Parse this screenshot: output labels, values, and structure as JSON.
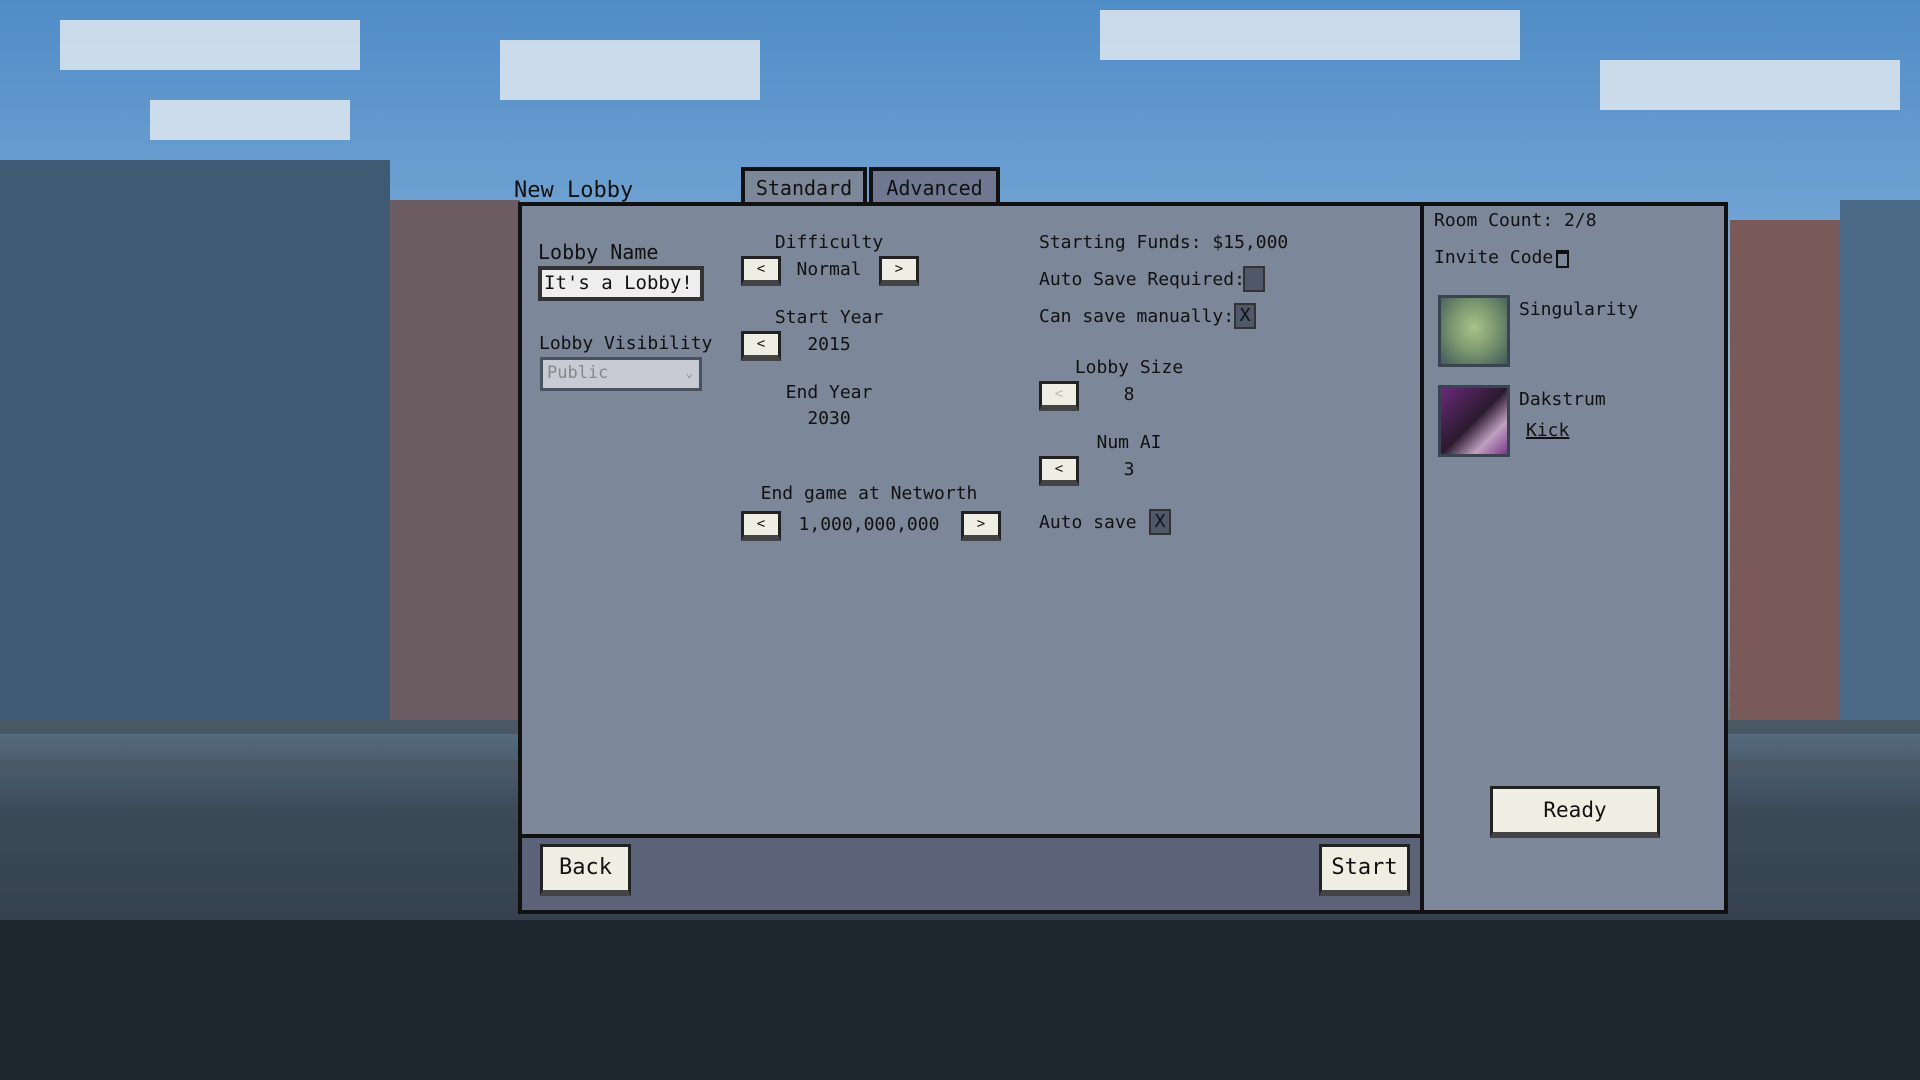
{
  "title": "New Lobby",
  "tabs": [
    {
      "label": "Standard",
      "active": true
    },
    {
      "label": "Advanced",
      "active": false
    }
  ],
  "lobby_name": {
    "label": "Lobby Name",
    "value": "It's a Lobby!"
  },
  "lobby_visibility": {
    "label": "Lobby Visibility",
    "value": "Public"
  },
  "difficulty": {
    "label": "Difficulty",
    "value": "Normal",
    "prev": "<",
    "next": ">"
  },
  "start_year": {
    "label": "Start Year",
    "value": "2015",
    "prev": "<"
  },
  "end_year": {
    "label": "End Year",
    "value": "2030"
  },
  "networth": {
    "label": "End game at Networth",
    "value": "1,000,000,000",
    "prev": "<",
    "next": ">"
  },
  "starting_funds": "Starting Funds: $15,000",
  "auto_save_required": {
    "label": "Auto Save Required:",
    "checked": false
  },
  "can_save_manually": {
    "label": "Can save manually:",
    "checked": true,
    "mark": "X"
  },
  "lobby_size": {
    "label": "Lobby Size",
    "value": "8",
    "prev": "<"
  },
  "num_ai": {
    "label": "Num AI",
    "value": "3",
    "prev": "<"
  },
  "auto_save": {
    "label": "Auto save",
    "checked": true,
    "mark": "X"
  },
  "room_count": "Room Count: 2/8",
  "invite_code": "Invite Code",
  "players": [
    {
      "name": "Singularity"
    },
    {
      "name": "Dakstrum",
      "action": "Kick"
    }
  ],
  "buttons": {
    "back": "Back",
    "start": "Start",
    "ready": "Ready"
  }
}
